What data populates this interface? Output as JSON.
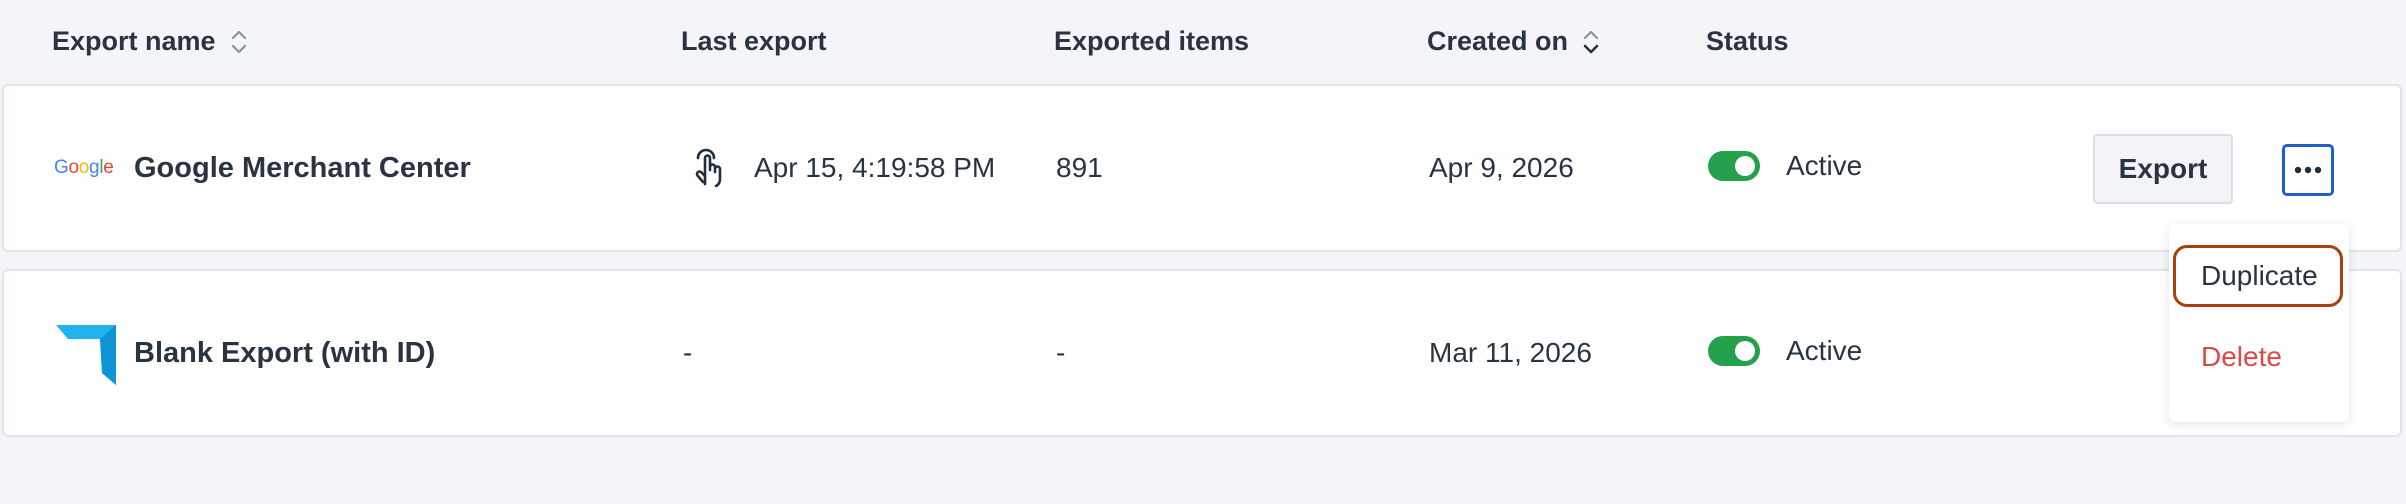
{
  "columns": {
    "export_name": "Export name",
    "last_export": "Last export",
    "exported_items": "Exported items",
    "created_on": "Created on",
    "status": "Status"
  },
  "rows": [
    {
      "logo_text": "Google",
      "name": "Google Merchant Center",
      "last_export": "Apr 15, 4:19:58 PM",
      "last_export_icon": "touch-hand-icon",
      "exported_items": "891",
      "created_on": "Apr 9, 2026",
      "status_label": "Active",
      "status_on": true
    },
    {
      "logo_icon": "blank-export-logo",
      "name": "Blank Export (with ID)",
      "last_export": "-",
      "exported_items": "-",
      "created_on": "Mar 11, 2026",
      "status_label": "Active",
      "status_on": true
    }
  ],
  "actions": {
    "export_label": "Export",
    "more_icon": "more-horizontal-icon"
  },
  "menu": {
    "duplicate_label": "Duplicate",
    "delete_label": "Delete"
  },
  "colors": {
    "toggle_active": "#25a04c",
    "focus_blue": "#1e62c9",
    "delete_red": "#e04848",
    "highlight_outline": "#a8410f",
    "blank_logo": "#1fb3f0"
  }
}
